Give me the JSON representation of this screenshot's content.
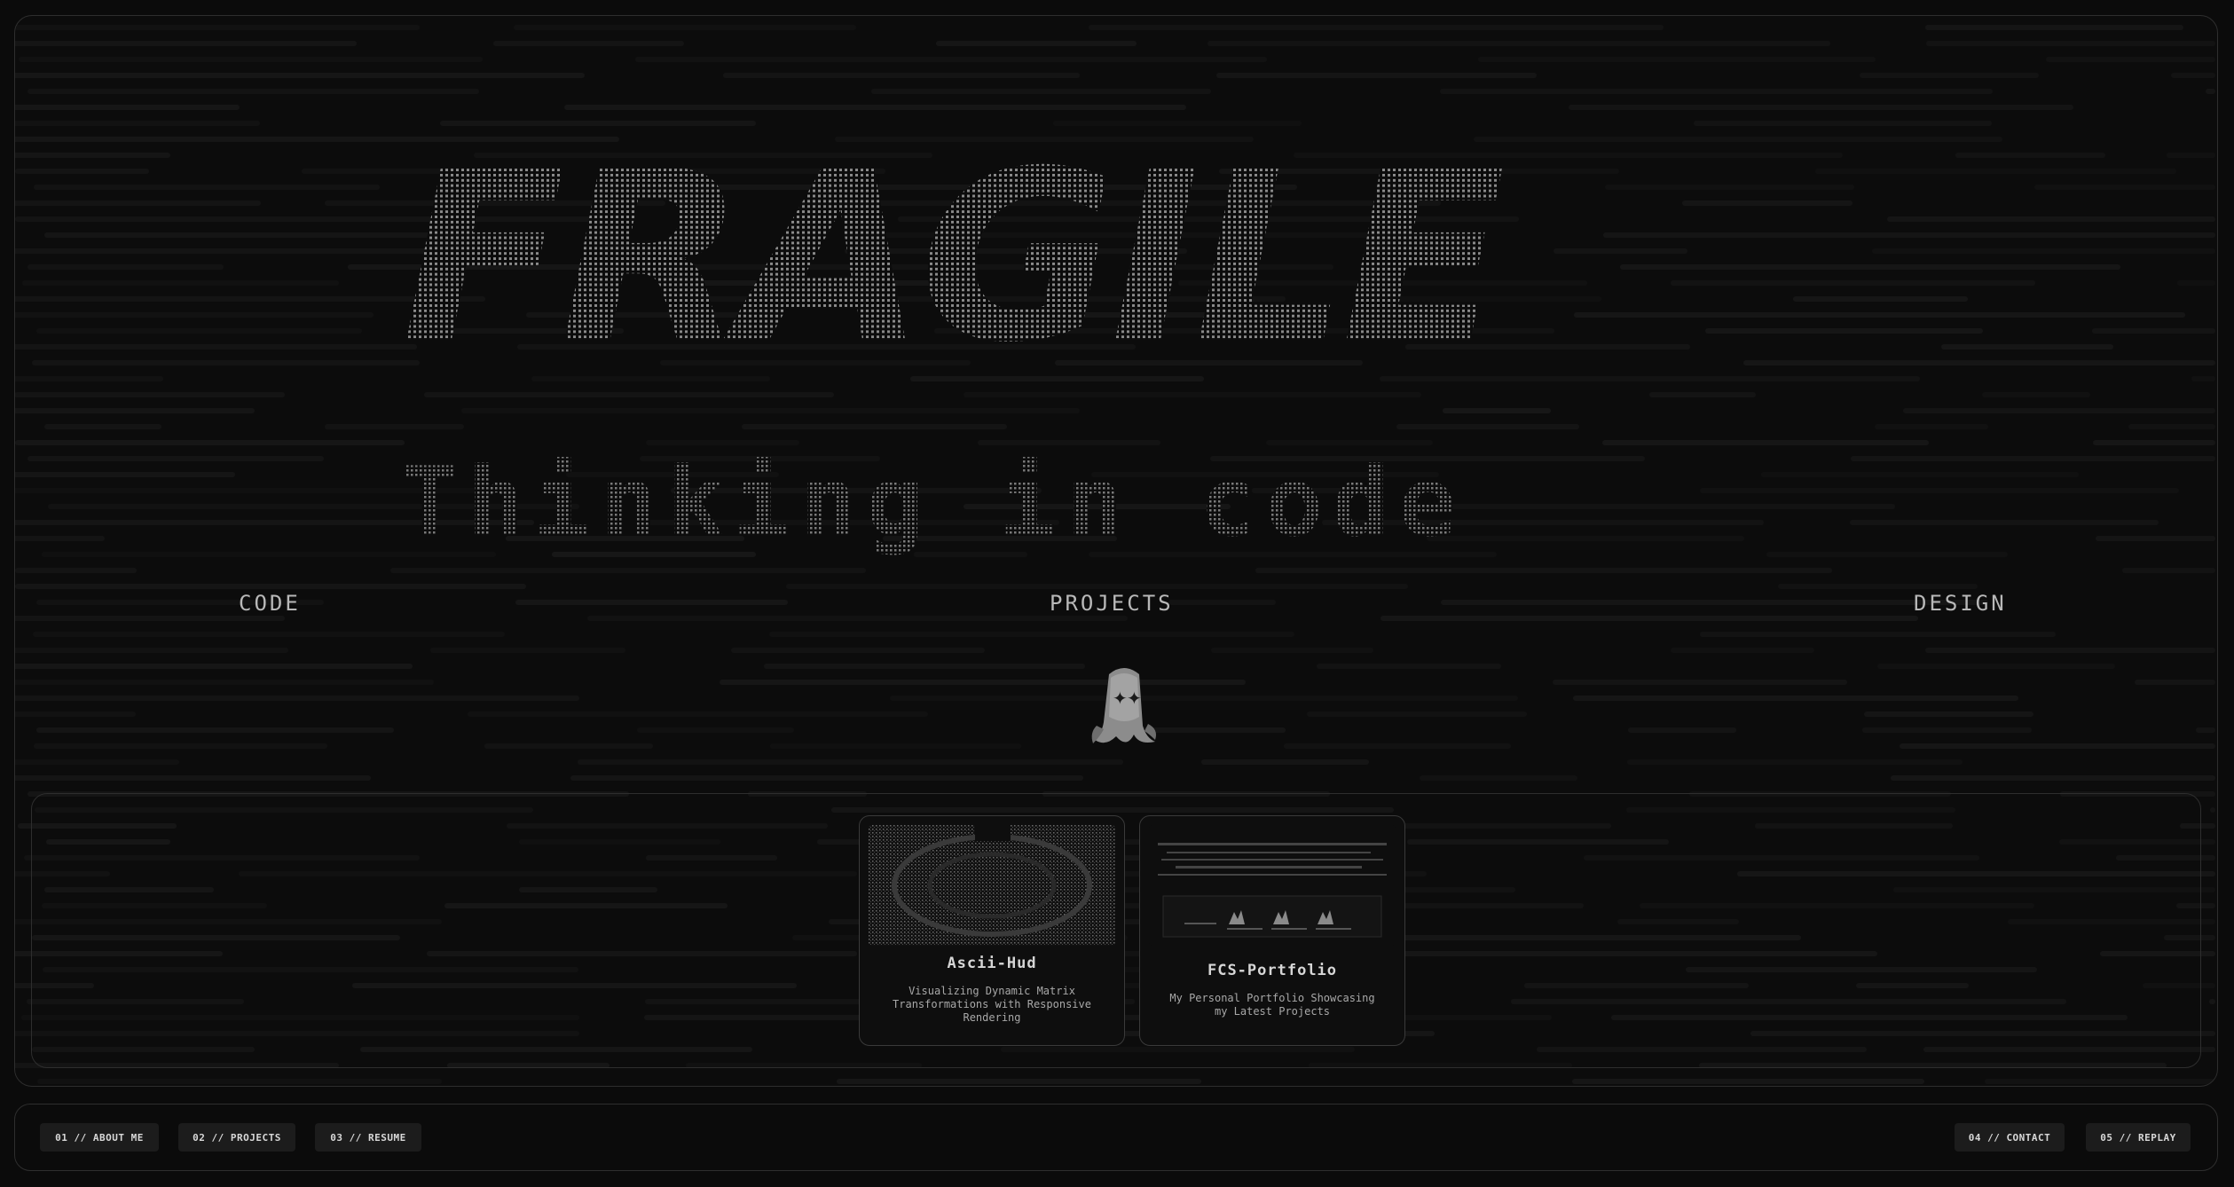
{
  "hero": {
    "title_art": "FRAGILE",
    "subtitle_art": "Thinking in code"
  },
  "sections": {
    "code_label": "CODE",
    "projects_label": "PROJECTS",
    "design_label": "DESIGN"
  },
  "cards": [
    {
      "title": "Ascii-Hud",
      "description": "Visualizing Dynamic Matrix Transformations with Responsive Rendering"
    },
    {
      "title": "FCS-Portfolio",
      "description": "My Personal Portfolio Showcasing my Latest Projects"
    }
  ],
  "nav": {
    "about": "01 // ABOUT ME",
    "projects": "02 // PROJECTS",
    "resume": "03 // RESUME",
    "contact": "04 // CONTACT",
    "replay": "05 // REPLAY"
  },
  "icons": {
    "mascot": "ghost-icon"
  },
  "colors": {
    "background": "#0b0b0b",
    "border": "#2e2e2e",
    "text": "#cfcfcf",
    "button_bg": "#1c1c1c"
  }
}
